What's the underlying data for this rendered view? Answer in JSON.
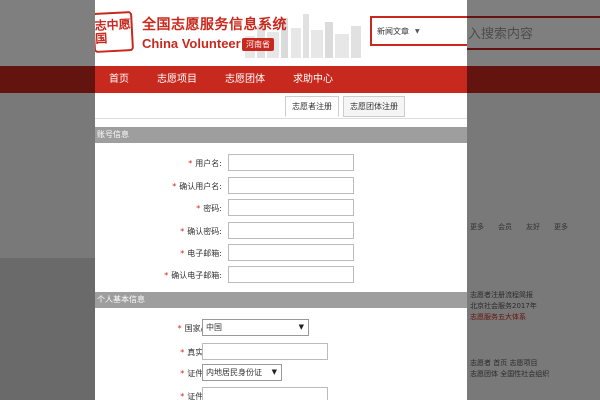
{
  "background": {
    "search_placeholder": "入搜索内容",
    "sidebar_links": [
      "更多",
      "会员",
      "友好",
      "更多"
    ],
    "news_lines": [
      "志愿者注册流程简报",
      "北京社会服务2017年",
      "志愿服务五大体系"
    ],
    "news_lines2": [
      "志愿者 首页 志愿项目",
      "志愿团体 全国性社会组织"
    ]
  },
  "header": {
    "seal_text": "志中愿国",
    "site_title": "全国志愿服务信息系统",
    "site_title_en": "China Volunteer",
    "province": "河南省",
    "search_category": "新闻文章"
  },
  "nav": {
    "items": [
      "首页",
      "志愿项目",
      "志愿团体",
      "求助中心"
    ]
  },
  "tabs": {
    "volunteer": "志愿者注册",
    "group": "志愿团体注册"
  },
  "account_section": {
    "title": "账号信息",
    "fields": [
      {
        "label": "用户名:",
        "value": ""
      },
      {
        "label": "确认用户名:",
        "value": ""
      },
      {
        "label": "密码:",
        "value": ""
      },
      {
        "label": "确认密码:",
        "value": ""
      },
      {
        "label": "电子邮箱:",
        "value": ""
      },
      {
        "label": "确认电子邮箱:",
        "value": ""
      }
    ]
  },
  "personal_section": {
    "title": "个人基本信息",
    "country_label": "国家/地区:",
    "country_value": "中国",
    "name_label": "真实姓名:",
    "id_type_label": "证件类型:",
    "id_type_value": "内地居民身份证",
    "id_number_label": "证件号码:"
  },
  "colors": {
    "brand_red": "#c8291e",
    "section_gray": "#9e9e9e"
  }
}
